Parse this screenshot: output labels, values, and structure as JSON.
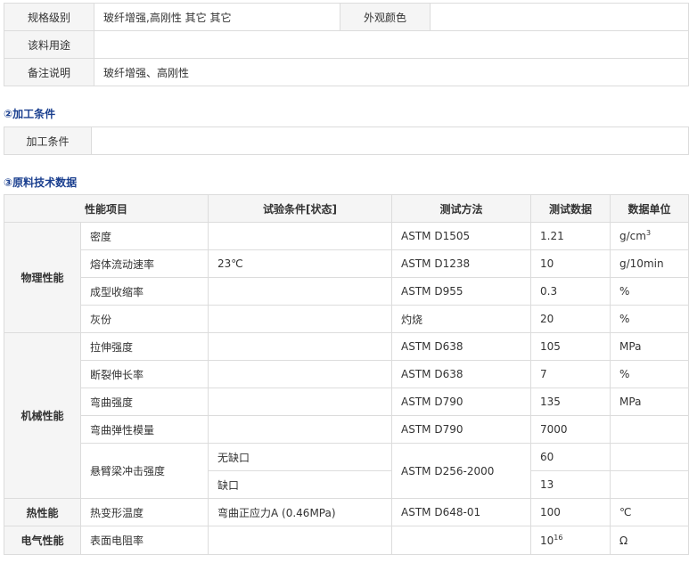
{
  "spec": {
    "grade_label": "规格级别",
    "grade_value": "玻纤增强,高刚性 其它 其它",
    "color_label": "外观颜色",
    "color_value": "",
    "use_label": "该料用途",
    "use_value": "",
    "note_label": "备注说明",
    "note_value": "玻纤增强、高刚性"
  },
  "processing": {
    "heading": "②加工条件",
    "label": "加工条件",
    "value": ""
  },
  "tech": {
    "heading": "③原料技术数据",
    "headers": [
      "性能项目",
      "试验条件[状态]",
      "测试方法",
      "测试数据",
      "数据单位"
    ],
    "categories": {
      "physical": "物理性能",
      "mechanical": "机械性能",
      "thermal": "热性能",
      "electrical": "电气性能"
    },
    "rows": [
      {
        "property": "密度",
        "condition": "",
        "method": "ASTM D1505",
        "value": "1.21",
        "unit": "g/cm",
        "unit_sup": "3"
      },
      {
        "property": "熔体流动速率",
        "condition": "23℃",
        "method": "ASTM D1238",
        "value": "10",
        "unit": "g/10min"
      },
      {
        "property": "成型收缩率",
        "condition": "",
        "method": "ASTM D955",
        "value": "0.3",
        "unit": "%"
      },
      {
        "property": "灰份",
        "condition": "",
        "method": "灼烧",
        "value": "20",
        "unit": "%"
      },
      {
        "property": "拉伸强度",
        "condition": "",
        "method": "ASTM D638",
        "value": "105",
        "unit": "MPa"
      },
      {
        "property": "断裂伸长率",
        "condition": "",
        "method": "ASTM D638",
        "value": "7",
        "unit": "%"
      },
      {
        "property": "弯曲强度",
        "condition": "",
        "method": "ASTM D790",
        "value": "135",
        "unit": "MPa"
      },
      {
        "property": "弯曲弹性模量",
        "condition": "",
        "method": "ASTM D790",
        "value": "7000",
        "unit": ""
      },
      {
        "property": "悬臂梁冲击强度",
        "condition": "无缺口",
        "method": "ASTM D256-2000",
        "value": "60",
        "unit": ""
      },
      {
        "property": "",
        "condition": "缺口",
        "method": "",
        "value": "13",
        "unit": ""
      },
      {
        "property": "热变形温度",
        "condition": "弯曲正应力A (0.46MPa)",
        "method": "ASTM D648-01",
        "value": "100",
        "unit": "℃"
      },
      {
        "property": "表面电阻率",
        "condition": "",
        "method": "",
        "value": "10",
        "value_sup": "16",
        "unit": "Ω"
      }
    ]
  }
}
